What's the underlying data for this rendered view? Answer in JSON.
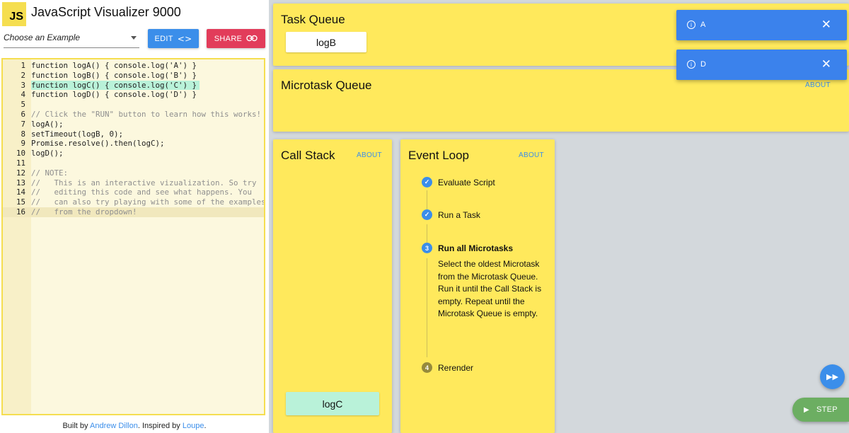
{
  "app": {
    "logo": "JS",
    "title": "JavaScript Visualizer 9000"
  },
  "toolbar": {
    "example_select": "Choose an Example",
    "edit_label": "EDIT",
    "edit_icon": "<>",
    "share_label": "SHARE",
    "share_icon": "link-icon"
  },
  "editor": {
    "lines": [
      {
        "n": "1",
        "text": "function logA() { console.log('A') }"
      },
      {
        "n": "2",
        "text": "function logB() { console.log('B') }"
      },
      {
        "n": "3",
        "text": "function logC() { console.log('C') }"
      },
      {
        "n": "4",
        "text": "function logD() { console.log('D') }"
      },
      {
        "n": "5",
        "text": ""
      },
      {
        "n": "6",
        "text": "// Click the \"RUN\" button to learn how this works!"
      },
      {
        "n": "7",
        "text": "logA();"
      },
      {
        "n": "8",
        "text": "setTimeout(logB, 0);"
      },
      {
        "n": "9",
        "text": "Promise.resolve().then(logC);"
      },
      {
        "n": "10",
        "text": "logD();"
      },
      {
        "n": "11",
        "text": ""
      },
      {
        "n": "12",
        "text": "// NOTE:"
      },
      {
        "n": "13",
        "text": "//   This is an interactive vizualization. So try"
      },
      {
        "n": "14",
        "text": "//   editing this code and see what happens. You"
      },
      {
        "n": "15",
        "text": "//   can also try playing with some of the examples"
      },
      {
        "n": "16",
        "text": "//   from the dropdown!"
      }
    ],
    "highlighted_line": "3"
  },
  "footer": {
    "prefix": "Built by ",
    "author": "Andrew Dillon",
    "middle": ". Inspired by ",
    "inspiration": "Loupe",
    "suffix": "."
  },
  "task_queue": {
    "title": "Task Queue",
    "items": [
      "logB"
    ]
  },
  "microtask_queue": {
    "title": "Microtask Queue",
    "about": "ABOUT",
    "items": []
  },
  "call_stack": {
    "title": "Call Stack",
    "about": "ABOUT",
    "items": [
      "logC"
    ]
  },
  "event_loop": {
    "title": "Event Loop",
    "about": "ABOUT",
    "steps": [
      {
        "num": "✓",
        "label": "Evaluate Script",
        "state": "done"
      },
      {
        "num": "✓",
        "label": "Run a Task",
        "state": "done"
      },
      {
        "num": "3",
        "label": "Run all Microtasks",
        "state": "active"
      },
      {
        "num": "4",
        "label": "Rerender",
        "state": "pending"
      }
    ],
    "active_description": "Select the oldest Microtask from the Microtask Queue. Run it until the Call Stack is empty. Repeat until the Microtask Queue is empty."
  },
  "toasts": [
    {
      "message": "A"
    },
    {
      "message": "D"
    }
  ],
  "controls": {
    "step_label": "STEP"
  },
  "colors": {
    "panel": "#ffe95c",
    "accent_blue": "#3b8eea",
    "share_red": "#e23c5a",
    "step_green": "#6cae62",
    "stack_item": "#b9f2d9"
  }
}
